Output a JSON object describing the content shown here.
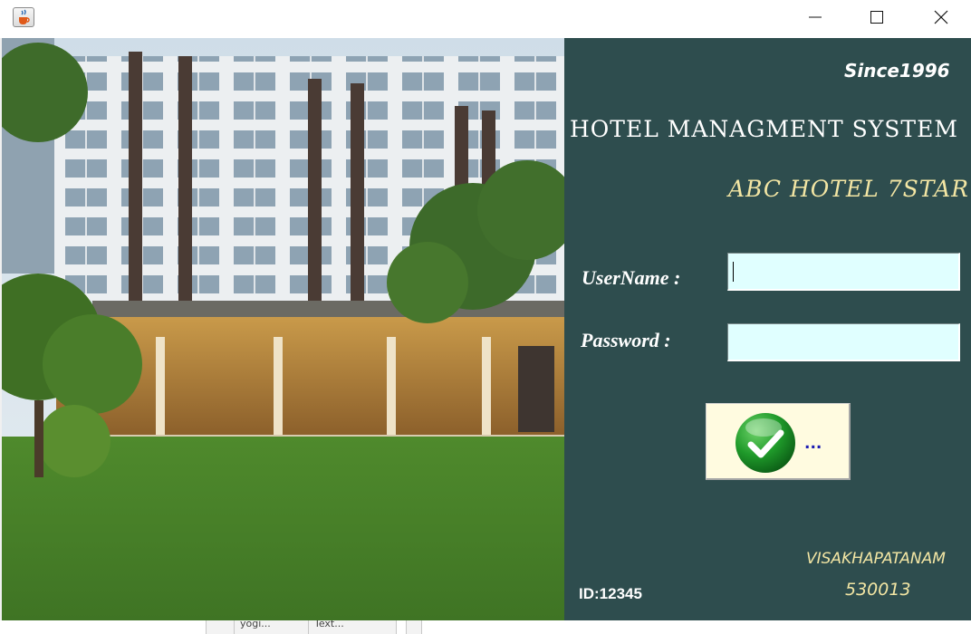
{
  "window": {
    "app_icon": "java-cup-icon",
    "controls": [
      "minimize-icon",
      "maximize-icon",
      "close-icon"
    ]
  },
  "panel": {
    "since": "Since1996",
    "heading": "HOTEL MANAGMENT SYSTEM",
    "hotel_name": "ABC HOTEL 7STAR",
    "username_label": "UserName :",
    "password_label": "Password :",
    "username_value": "",
    "password_value": "",
    "login_label": "...",
    "city": "VISAKHAPATANAM",
    "pin": "530013",
    "id": "ID:12345"
  },
  "taskbar": {
    "items": [
      "yogi...",
      "Text..."
    ]
  },
  "colors": {
    "panel_bg": "#2e4d4e",
    "field_bg": "#e0ffff",
    "button_bg": "#fffbe0",
    "accent_text": "#f3e6a4"
  }
}
